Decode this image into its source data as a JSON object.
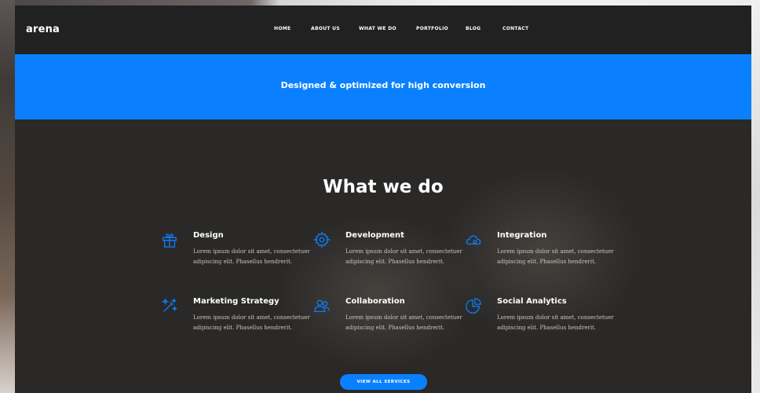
{
  "brand": {
    "logo_text": "arena"
  },
  "nav": {
    "items": [
      {
        "label": "HOME"
      },
      {
        "label": "ABOUT US"
      },
      {
        "label": "WHAT WE DO"
      },
      {
        "label": "PORTFOLIO"
      },
      {
        "label": "BLOG"
      },
      {
        "label": "CONTACT"
      }
    ]
  },
  "banner": {
    "text": "Designed & optimized for high conversion"
  },
  "services": {
    "title": "What we do",
    "items": [
      {
        "icon": "gift-icon",
        "title": "Design",
        "description": "Lorem ipsum dolor sit amet, consectetuer adipiscing elit. Phasellus hendrerit."
      },
      {
        "icon": "gear-icon",
        "title": "Development",
        "description": "Lorem ipsum dolor sit amet, consectetuer adipiscing elit. Phasellus hendrerit."
      },
      {
        "icon": "cloud-icon",
        "title": "Integration",
        "description": "Lorem ipsum dolor sit amet, consectetuer adipiscing elit. Phasellus hendrerit."
      },
      {
        "icon": "magic-wand-icon",
        "title": "Marketing Strategy",
        "description": "Lorem ipsum dolor sit amet, consectetuer adipiscing elit. Phasellus hendrerit."
      },
      {
        "icon": "users-icon",
        "title": "Collaboration",
        "description": "Lorem ipsum dolor sit amet, consectetuer adipiscing elit. Phasellus hendrerit."
      },
      {
        "icon": "pie-chart-icon",
        "title": "Social Analytics",
        "description": "Lorem ipsum dolor sit amet, consectetuer adipiscing elit. Phasellus hendrerit."
      }
    ],
    "cta_label": "VIEW ALL SERVICES"
  },
  "colors": {
    "accent": "#0a80ff",
    "header_bg": "#212121",
    "section_bg": "#2a2928",
    "text_light": "#ffffff"
  }
}
